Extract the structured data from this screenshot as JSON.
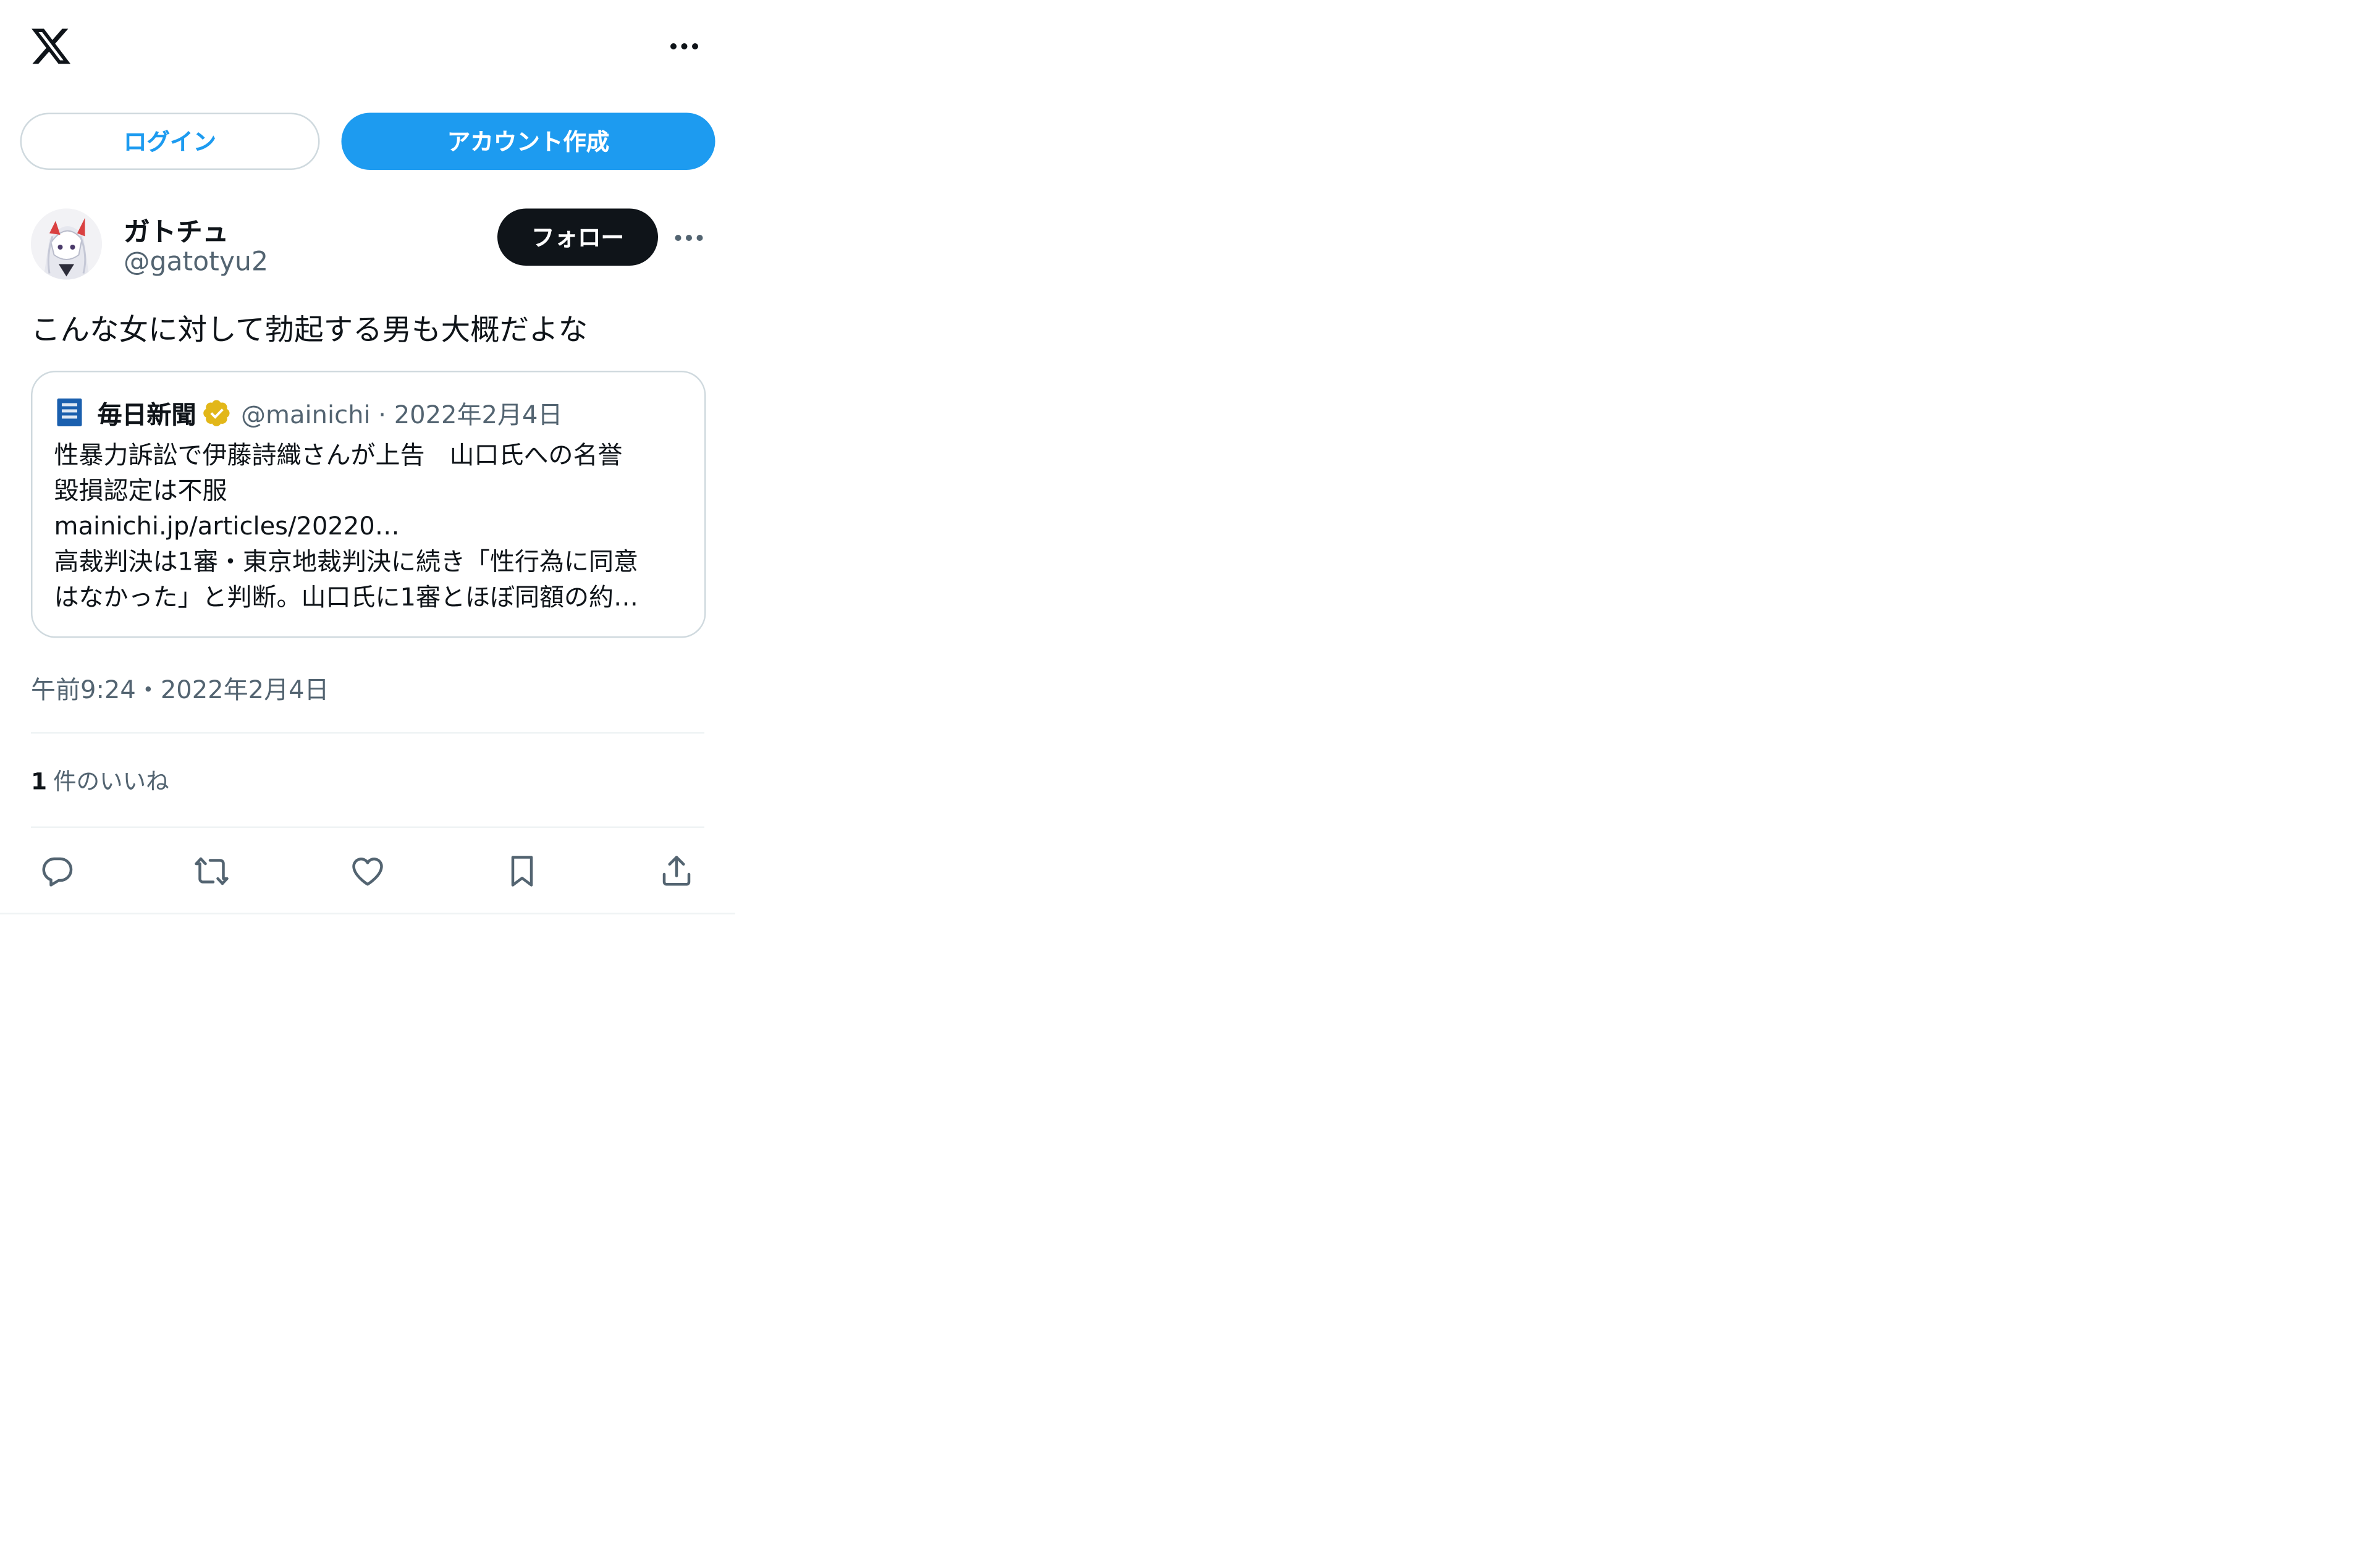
{
  "header": {
    "logo_icon": "x-logo-icon",
    "more_icon": "more-icon"
  },
  "auth": {
    "login_label": "ログイン",
    "signup_label": "アカウント作成"
  },
  "post": {
    "author_name": "ガトチュ",
    "author_handle": "@gatotyu2",
    "follow_label": "フォロー",
    "text": "こんな女に対して勃起する男も大概だよな",
    "timestamp": "午前9:24・2022年2月4日",
    "likes_count": "1",
    "likes_label": "件のいいね"
  },
  "quote": {
    "source_name": "毎日新聞",
    "source_meta": "@mainichi · 2022年2月4日",
    "lines": [
      "性暴力訴訟で伊藤詩織さんが上告　山口氏への名誉",
      "毀損認定は不服",
      "mainichi.jp/articles/20220…",
      "高裁判決は1審・東京地裁判決に続き「性行為に同意",
      "はなかった」と判断。山口氏に1審とほぼ同額の約…"
    ]
  },
  "actions": [
    "reply-icon",
    "repost-icon",
    "like-icon",
    "bookmark-icon",
    "share-icon"
  ],
  "colors": {
    "accent": "#1d9bf0",
    "text": "#0f1419",
    "muted": "#536471",
    "border": "#cfd9de",
    "verified_gold": "#e2b719"
  }
}
